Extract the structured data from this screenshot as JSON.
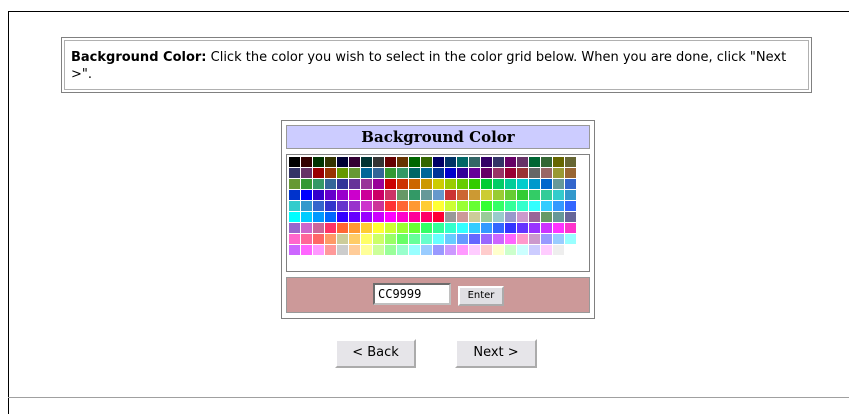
{
  "instructions": {
    "label": "Background Color:",
    "text": " Click the color you wish to select in the color grid below. When you are done, click \"Next >\"."
  },
  "picker": {
    "title": "Background Color",
    "hex_value": "CC9999",
    "enter_label": "Enter",
    "grid_colors": [
      [
        "#000000",
        "#330000",
        "#003300",
        "#333300",
        "#000033",
        "#330033",
        "#003333",
        "#333333",
        "#660000",
        "#663300",
        "#006600",
        "#336600",
        "#000066",
        "#003366",
        "#006666",
        "#336666",
        "#330066",
        "#333366",
        "#660066",
        "#663366",
        "#006633",
        "#336633",
        "#666600",
        "#666633"
      ],
      [
        "#333366",
        "#663366",
        "#990000",
        "#993300",
        "#669900",
        "#669933",
        "#006699",
        "#336699",
        "#339933",
        "#339966",
        "#006666",
        "#006699",
        "#003399",
        "#0000cc",
        "#330099",
        "#660099",
        "#660066",
        "#993366",
        "#990033",
        "#993333",
        "#666666",
        "#996666",
        "#999933",
        "#996633"
      ],
      [
        "#669933",
        "#339933",
        "#339966",
        "#336699",
        "#333399",
        "#663399",
        "#993399",
        "#990099",
        "#cc0000",
        "#cc3300",
        "#cc6600",
        "#cc9900",
        "#cccc00",
        "#99cc00",
        "#66cc00",
        "#33cc00",
        "#00cc33",
        "#00cc66",
        "#00cc99",
        "#00cccc",
        "#0099cc",
        "#0066cc",
        "#669999",
        "#3366cc"
      ],
      [
        "#0033cc",
        "#0000ff",
        "#3300cc",
        "#6600cc",
        "#9900cc",
        "#cc00cc",
        "#cc0099",
        "#cc0066",
        "#cc3366",
        "#669966",
        "#339966",
        "#669999",
        "#6699cc",
        "#cc3333",
        "#cc6633",
        "#cc9933",
        "#cccc33",
        "#99cc33",
        "#66cc33",
        "#33cc33",
        "#33cc66",
        "#33cc99",
        "#33cccc",
        "#3399cc"
      ],
      [
        "#33cccc",
        "#3399cc",
        "#3366cc",
        "#3333cc",
        "#6633cc",
        "#9933cc",
        "#cc33cc",
        "#cc3399",
        "#ff3333",
        "#ff6633",
        "#ff9933",
        "#ffcc33",
        "#ffff33",
        "#ccff33",
        "#99ff33",
        "#66ff33",
        "#33ff33",
        "#33ff66",
        "#33ff99",
        "#33ffcc",
        "#33ffff",
        "#33ccff",
        "#3399ff",
        "#3366ff"
      ],
      [
        "#00ffff",
        "#00ccff",
        "#0099ff",
        "#0066ff",
        "#3300ff",
        "#6600ff",
        "#9900ff",
        "#cc00ff",
        "#ff00ff",
        "#ff00cc",
        "#ff0099",
        "#ff0066",
        "#ff0033",
        "#999999",
        "#cc9999",
        "#cccc99",
        "#99cc99",
        "#99cccc",
        "#9999cc",
        "#cc99cc",
        "#996699",
        "#669966",
        "#669999",
        "#666699"
      ],
      [
        "#9966cc",
        "#cc66cc",
        "#cc6699",
        "#ff3366",
        "#ff6633",
        "#ff9933",
        "#ffcc33",
        "#ffff33",
        "#ccff33",
        "#99ff33",
        "#66ff33",
        "#33ff66",
        "#33ff99",
        "#33ffcc",
        "#33ffff",
        "#33ccff",
        "#3399ff",
        "#3366ff",
        "#3333ff",
        "#6633ff",
        "#9933ff",
        "#cc33ff",
        "#ff33ff",
        "#ff33cc"
      ],
      [
        "#ff66cc",
        "#ff6699",
        "#ff6666",
        "#ff9966",
        "#cccc99",
        "#ffcc66",
        "#ffff66",
        "#ccff66",
        "#99ff66",
        "#66ff66",
        "#66ff99",
        "#66ffcc",
        "#66ffff",
        "#66ccff",
        "#6699ff",
        "#6666ff",
        "#9966ff",
        "#cc66ff",
        "#ff66ff",
        "#ff99cc",
        "#cc99cc",
        "#9999ff",
        "#99ccff",
        "#99ffff"
      ],
      [
        "#cc66ff",
        "#ff66ff",
        "#ff99ff",
        "#ff9999",
        "#cccccc",
        "#ffcc99",
        "#ffff99",
        "#ccff99",
        "#99ff99",
        "#99ffcc",
        "#99ffff",
        "#99ccff",
        "#9999ff",
        "#cc99ff",
        "#ff99ff",
        "#ffccff",
        "#ffcccc",
        "#ffffcc",
        "#ccffcc",
        "#ccffff",
        "#ccccff",
        "#ffccff",
        "#eeeeee",
        "#ffffff"
      ]
    ]
  },
  "nav": {
    "back_label": "< Back",
    "next_label": "Next >"
  }
}
